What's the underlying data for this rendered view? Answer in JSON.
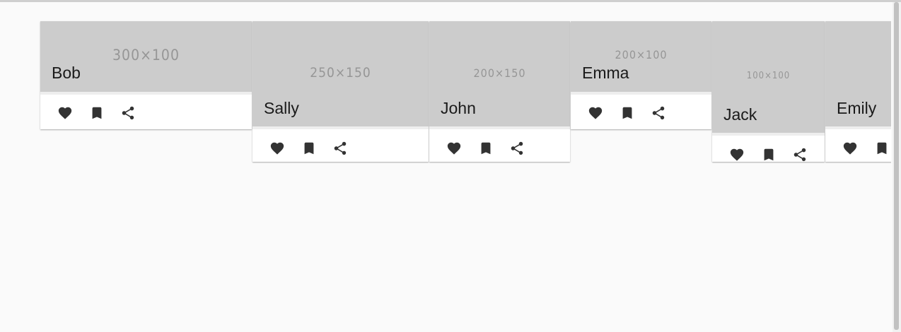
{
  "colors": {
    "background": "#fafafa",
    "card": "#ffffff",
    "media_placeholder": "#cccccc",
    "placeholder_text": "#969696",
    "icon": "#333333"
  },
  "cards": [
    {
      "title": "Bob",
      "placeholder": "300×100"
    },
    {
      "title": "Sally",
      "placeholder": "250×150"
    },
    {
      "title": "John",
      "placeholder": "200×150"
    },
    {
      "title": "Emma",
      "placeholder": "200×100"
    },
    {
      "title": "Jack",
      "placeholder": "100×100"
    },
    {
      "title": "Emily",
      "placeholder": ""
    }
  ],
  "actions": {
    "favorite_icon": "heart-icon",
    "bookmark_icon": "bookmark-icon",
    "share_icon": "share-icon"
  }
}
